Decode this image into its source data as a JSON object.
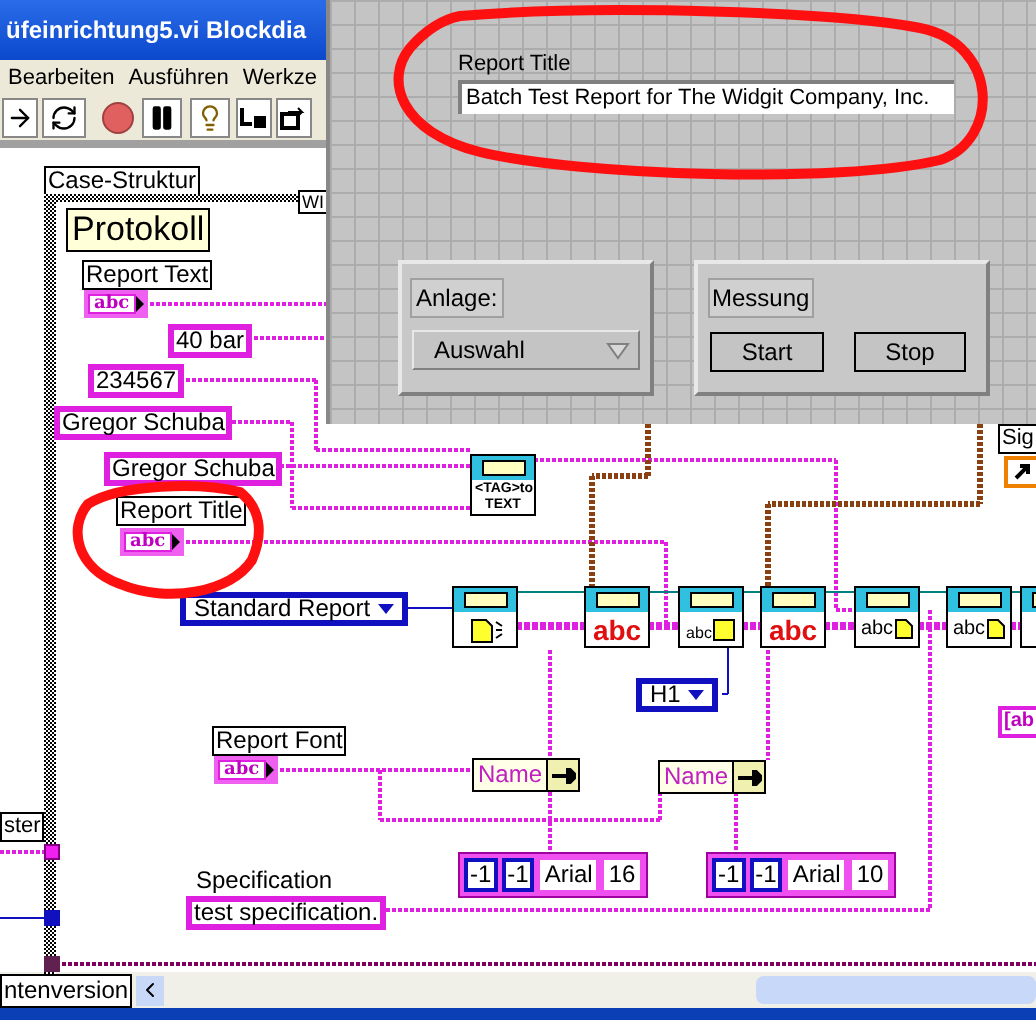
{
  "window": {
    "title": "üfeinrichtung5.vi Blockdia"
  },
  "menu": [
    "Bearbeiten",
    "Ausführen",
    "Werkze"
  ],
  "front_panel": {
    "report_title": {
      "label": "Report Title",
      "value": "Batch Test Report for The Widgit Company, Inc."
    },
    "anlage": {
      "label": "Anlage:",
      "value": "Auswahl"
    },
    "messung": {
      "label": "Messung",
      "buttons": [
        "Start",
        "Stop"
      ]
    }
  },
  "diagram": {
    "case_label": "Case-Struktur",
    "case_selector": "Protokoll",
    "loop_label": "WI",
    "controls": [
      {
        "label": "Report Text",
        "glyph": "abc"
      },
      {
        "label": "Report Title",
        "glyph": "abc"
      },
      {
        "label": "Report Font",
        "glyph": "abc"
      }
    ],
    "constants": [
      "40 bar",
      "234567",
      "Gregor Schuba",
      "Gregor Schuba"
    ],
    "enums": [
      "Standard Report",
      "H1"
    ],
    "subvis": [
      {
        "kind": "tag",
        "glyph": "<TAG>to TEXT"
      },
      {
        "kind": "new"
      },
      {
        "kind": "style",
        "glyph": "abc"
      },
      {
        "kind": "heading",
        "glyph": "abc"
      },
      {
        "kind": "style",
        "glyph": "abc"
      },
      {
        "kind": "append",
        "glyph": "abc"
      },
      {
        "kind": "append",
        "glyph": "abc"
      },
      {
        "kind": "partial"
      }
    ],
    "unbundles": [
      "Name",
      "Name"
    ],
    "fonts": [
      [
        {
          "kind": "num",
          "text": "-1"
        },
        {
          "kind": "num",
          "text": "-1"
        },
        {
          "kind": "str",
          "text": "Arial"
        },
        {
          "kind": "str",
          "text": "16"
        }
      ],
      [
        {
          "kind": "num",
          "text": "-1"
        },
        {
          "kind": "num",
          "text": "-1"
        },
        {
          "kind": "str",
          "text": "Arial"
        },
        {
          "kind": "str",
          "text": "10"
        }
      ]
    ],
    "specification": {
      "label": "Specification",
      "value": "test specification."
    },
    "left_label": "ster",
    "right_label": "Sig",
    "right_constant": "[ab"
  },
  "tab": "ntenversion"
}
